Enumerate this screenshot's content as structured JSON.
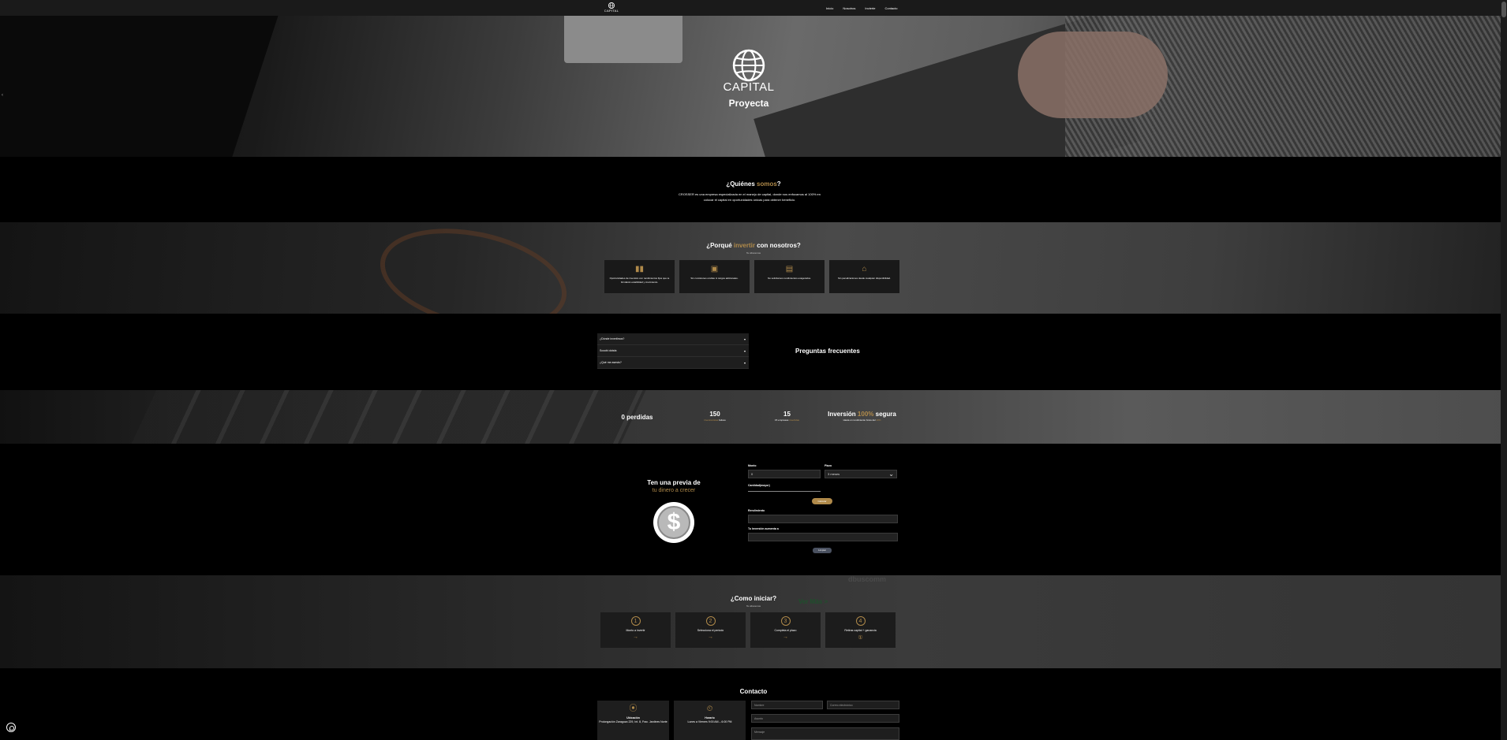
{
  "nav": {
    "brand": "CAPITAL",
    "links": [
      "Inicio",
      "Nosotros",
      "Invierte",
      "Contacto"
    ]
  },
  "hero": {
    "title": "CAPITAL",
    "subtitle": "Proyecta",
    "prev_arrow": "‹",
    "next_arrow": "›"
  },
  "about": {
    "heading_pre": "¿Quiénes ",
    "heading_accent": "somos",
    "heading_post": "?",
    "text": "CROSSER es una empresa especializada en el manejo de capital, donde nos enfocamos al 100% en colocar el capital en oportunidades únicas para obtener beneficio."
  },
  "why": {
    "heading_pre": "¿Porqué ",
    "heading_accent": "invertir",
    "heading_post": " con nosotros?",
    "small": "Te ofrecemos",
    "cards": [
      {
        "icon": "▮▮",
        "text": "Oportunidades de inversión con rendimientos fijos que te brindarán estabilidad y crecimiento."
      },
      {
        "icon": "▣",
        "text": "Sin comisiones ocultas ni cargos adicionales."
      },
      {
        "icon": "▤",
        "text": "No solicitamos rendimientos exagerados."
      },
      {
        "icon": "⌂",
        "text": "Sin penalizaciones desde cualquier disponibilidad."
      }
    ]
  },
  "faq": {
    "title": "Preguntas frecuentes",
    "items": [
      "¿Dónde invertimos?",
      "Scoobi dobda",
      "¿Qué me asesto?"
    ]
  },
  "stats": [
    {
      "num": "0 perdidas",
      "lbl_a": "",
      "lbl_b": ""
    },
    {
      "num": "150",
      "lbl_a": "inversionistas ",
      "lbl_b": "felices"
    },
    {
      "num": "15",
      "lbl_a": "15 empresas ",
      "lbl_b": "invertidas"
    },
    {
      "num_pre": "Inversión ",
      "num_accent": "100%",
      "num_post": " segura",
      "lbl_a": "Hasta un rendimiento bruto del ",
      "lbl_b": "10%"
    }
  ],
  "simulator": {
    "lead1": "Ten una previa de",
    "lead2": "tu dinero a crecer",
    "coin_symbol": "$",
    "monto_label": "Monto",
    "monto_value": "0",
    "plazo_label": "Plazo",
    "plazo_value": "3 meses",
    "cantidad_label": "Cantidad(mayor)",
    "calc_button": "Calcular",
    "rend_label": "Rendimiento",
    "total_label": "Tu inversión aumenta a",
    "clear_button": "Limpiar"
  },
  "start": {
    "heading": "¿Como iniciar?",
    "small": "Te ofrecemos",
    "screen_text": "dbuscomm",
    "ghost_button": "Ver Más >",
    "steps": [
      {
        "n": "1",
        "text": "Monto a invertir",
        "ar": "→"
      },
      {
        "n": "2",
        "text": "Selecciona el periodo",
        "ar": "→"
      },
      {
        "n": "3",
        "text": "Completa el plazo",
        "ar": "→"
      },
      {
        "n": "4",
        "text": "Retiras capital + ganancia",
        "ar": "①"
      }
    ]
  },
  "contact": {
    "heading": "Contacto",
    "boxes": [
      {
        "icon": "⦿",
        "title": "Ubicación",
        "text": "Prolongación Zaragoza 229, Int. 8, Frac. Jardines Norte"
      },
      {
        "icon": "⏲",
        "title": "Horario",
        "text": "Lunes a Viernes 9:00 AM – 6:00 PM"
      }
    ],
    "name_ph": "Nombre",
    "mail_ph": "Correo electrónico",
    "subject_ph": "Asunto",
    "msg_ph": "Mensaje"
  },
  "colors": {
    "accent": "#b08a4a",
    "background": "#000000",
    "card": "#1c1c1c"
  }
}
